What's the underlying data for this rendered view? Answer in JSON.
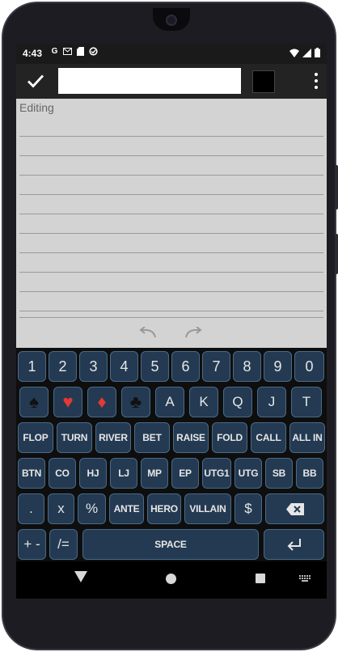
{
  "status_bar": {
    "time": "4:43",
    "left_icons": [
      "google-icon",
      "gmail-icon",
      "sd-card-icon",
      "sync-icon"
    ],
    "right_icons": [
      "wifi-icon",
      "signal-icon",
      "battery-icon"
    ]
  },
  "toolbar": {
    "title_value": "",
    "selected_color": "#000000"
  },
  "editor": {
    "mode_label": "Editing",
    "line_count": 11
  },
  "keyboard": {
    "row1": [
      "1",
      "2",
      "3",
      "4",
      "5",
      "6",
      "7",
      "8",
      "9",
      "0"
    ],
    "row2": [
      "♠",
      "♥",
      "♦",
      "♣",
      "A",
      "K",
      "Q",
      "J",
      "T"
    ],
    "row3": [
      "FLOP",
      "TURN",
      "RIVER",
      "BET",
      "RAISE",
      "FOLD",
      "CALL",
      "ALL IN"
    ],
    "row4": [
      "BTN",
      "CO",
      "HJ",
      "LJ",
      "MP",
      "EP",
      "UTG1",
      "UTG",
      "SB",
      "BB"
    ],
    "row5": [
      ".",
      "x",
      "%",
      "ANTE",
      "HERO",
      "VILLAIN",
      "$"
    ],
    "row6": [
      "+ -",
      "/=",
      "SPACE"
    ]
  },
  "colors": {
    "key_bg": "#233a52",
    "key_border": "#4a6a86",
    "heart_diamond": "#e53935",
    "editor_bg": "#d3d3d3",
    "toolbar_bg": "#232323"
  }
}
